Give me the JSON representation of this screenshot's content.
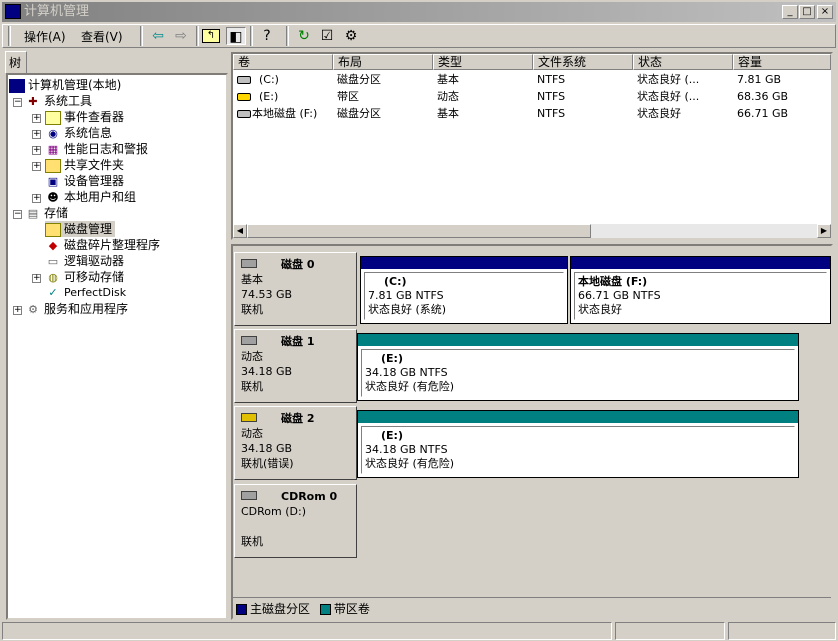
{
  "window": {
    "title": "计算机管理"
  },
  "menu": {
    "action": "操作(A)",
    "view": "查看(V)"
  },
  "tree_tab": "树",
  "tree": [
    "计算机管理(本地)",
    "系统工具",
    "事件查看器",
    "系统信息",
    "性能日志和警报",
    "共享文件夹",
    "设备管理器",
    "本地用户和组",
    "存储",
    "磁盘管理",
    "磁盘碎片整理程序",
    "逻辑驱动器",
    "可移动存储",
    "PerfectDisk",
    "服务和应用程序"
  ],
  "list": {
    "headers": [
      "卷",
      "布局",
      "类型",
      "文件系统",
      "状态",
      "容量"
    ],
    "rows": [
      [
        "(C:)",
        "磁盘分区",
        "基本",
        "NTFS",
        "状态良好 (...",
        "7.81 GB"
      ],
      [
        "(E:)",
        "带区",
        "动态",
        "NTFS",
        "状态良好 (...",
        "68.36 GB"
      ],
      [
        "本地磁盘 (F:)",
        "磁盘分区",
        "基本",
        "NTFS",
        "状态良好",
        "66.71 GB"
      ]
    ]
  },
  "disks": [
    {
      "name": "磁盘 0",
      "type": "基本",
      "size": "74.53 GB",
      "status": "联机",
      "parts": [
        {
          "label": "(C:)",
          "size": "7.81 GB NTFS",
          "status": "状态良好 (系统)"
        },
        {
          "label": "本地磁盘  (F:)",
          "size": "66.71 GB NTFS",
          "status": "状态良好"
        }
      ]
    },
    {
      "name": "磁盘 1",
      "type": "动态",
      "size": "34.18 GB",
      "status": "联机",
      "parts": [
        {
          "label": "(E:)",
          "size": "34.18 GB NTFS",
          "status": "状态良好 (有危险)"
        }
      ]
    },
    {
      "name": "磁盘 2",
      "type": "动态",
      "size": "34.18 GB",
      "status": "联机(错误)",
      "parts": [
        {
          "label": "(E:)",
          "size": "34.18 GB NTFS",
          "status": "状态良好 (有危险)"
        }
      ]
    },
    {
      "name": "CDRom 0",
      "type": "CDRom (D:)",
      "status": "联机"
    }
  ],
  "legend": [
    {
      "label": "主磁盘分区",
      "color": "#000080"
    },
    {
      "label": "带区卷",
      "color": "#008080"
    }
  ]
}
